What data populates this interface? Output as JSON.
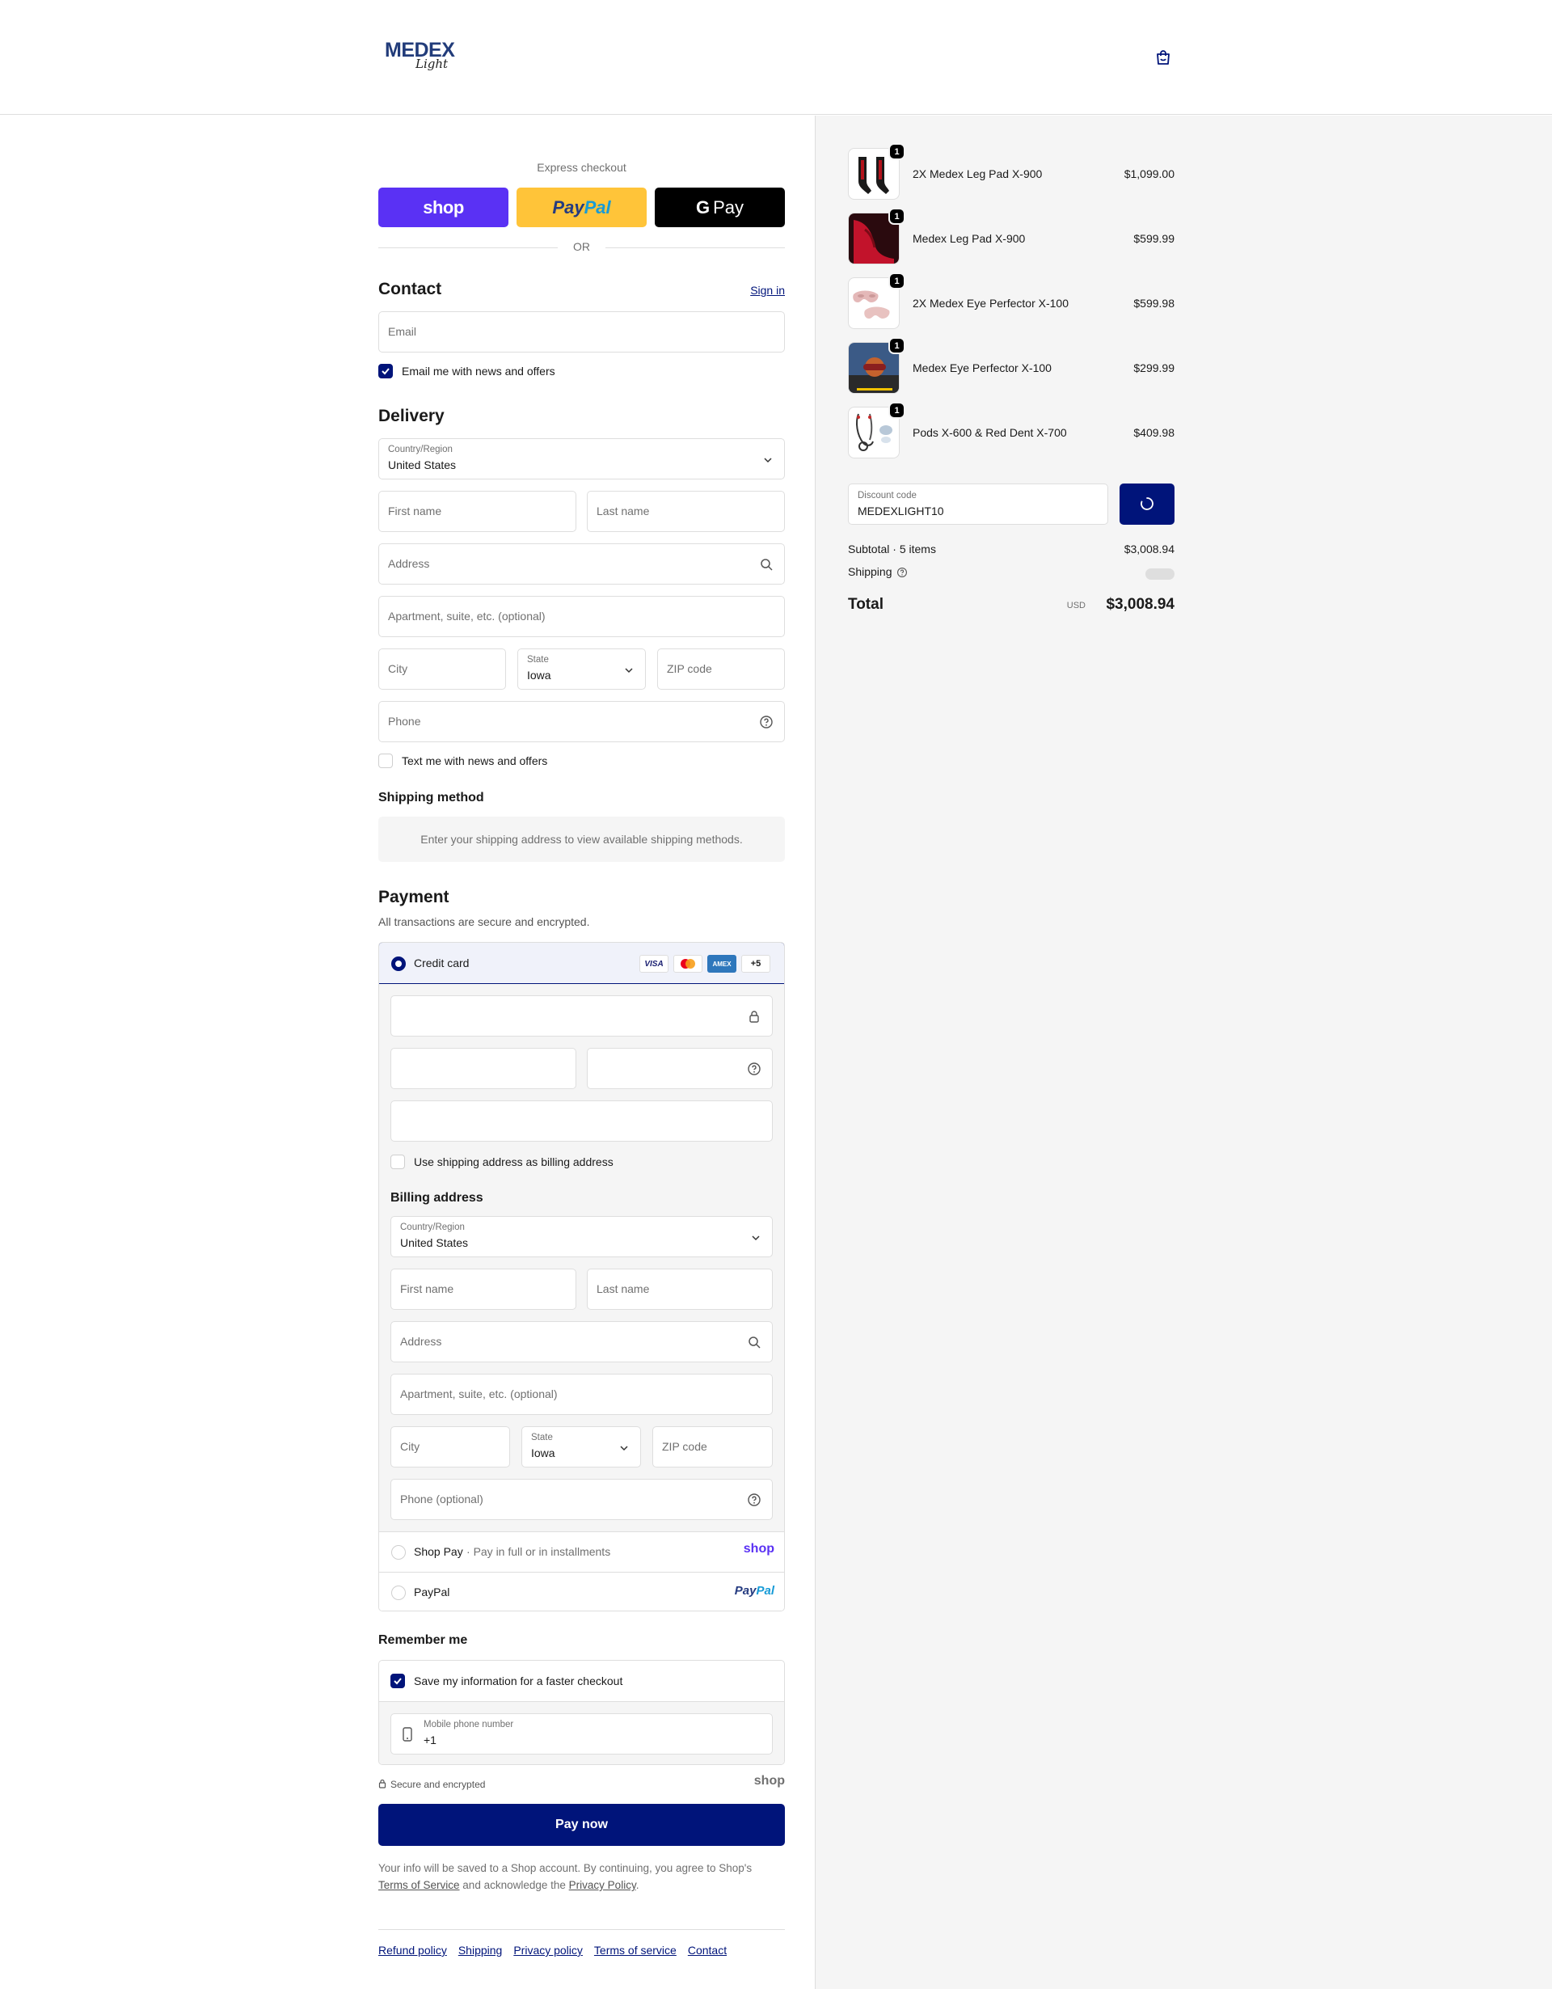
{
  "header": {
    "logo_word": "MEDEX",
    "logo_script": "Light"
  },
  "express": {
    "label": "Express checkout",
    "shop_label": "shop",
    "paypal_part1": "Pay",
    "paypal_part2": "Pal",
    "gpay_g": "G",
    "gpay_label": "Pay",
    "or_text": "OR"
  },
  "contact": {
    "title": "Contact",
    "sign_in": "Sign in",
    "email_placeholder": "Email",
    "news_label": "Email me with news and offers",
    "news_checked": true
  },
  "delivery": {
    "title": "Delivery",
    "country_label": "Country/Region",
    "country_value": "United States",
    "first_name": "First name",
    "last_name": "Last name",
    "address": "Address",
    "apartment": "Apartment, suite, etc. (optional)",
    "city": "City",
    "state_label": "State",
    "state_value": "Iowa",
    "zip": "ZIP code",
    "phone": "Phone",
    "text_label": "Text me with news and offers",
    "text_checked": false
  },
  "shipping_method": {
    "title": "Shipping method",
    "info": "Enter your shipping address to view available shipping methods."
  },
  "payment": {
    "title": "Payment",
    "subtitle": "All transactions are secure and encrypted.",
    "credit_card_label": "Credit card",
    "card_badges": [
      "VISA",
      "MC",
      "AMEX",
      "+5"
    ],
    "use_shipping_label": "Use shipping address as billing address",
    "billing_title": "Billing address",
    "billing": {
      "country_label": "Country/Region",
      "country_value": "United States",
      "first_name": "First name",
      "last_name": "Last name",
      "address": "Address",
      "apartment": "Apartment, suite, etc. (optional)",
      "city": "City",
      "state_label": "State",
      "state_value": "Iowa",
      "zip": "ZIP code",
      "phone": "Phone (optional)"
    },
    "shop_pay_label": "Shop Pay",
    "shop_pay_sub": "Pay in full or in installments",
    "shop_pay_logo": "shop",
    "paypal_label": "PayPal",
    "paypal_logo_1": "Pay",
    "paypal_logo_2": "Pal"
  },
  "remember": {
    "title": "Remember me",
    "save_label": "Save my information for a faster checkout",
    "mobile_label": "Mobile phone number",
    "mobile_value": "+1",
    "secure_text": "Secure and encrypted",
    "shop_logo": "shop"
  },
  "pay_now": "Pay now",
  "legal": {
    "line1": "Your info will be saved to a Shop account. By continuing, you agree to Shop's",
    "tos": "Terms of Service",
    "and_ack": "and acknowledge the",
    "privacy": "Privacy Policy",
    "end": "."
  },
  "footer_links": [
    "Refund policy",
    "Shipping",
    "Privacy policy",
    "Terms of service",
    "Contact"
  ],
  "order": {
    "items": [
      {
        "name": "2X Medex Leg Pad X-900",
        "price": "$1,099.00",
        "qty": "1"
      },
      {
        "name": "Medex Leg Pad X-900",
        "price": "$599.99",
        "qty": "1"
      },
      {
        "name": "2X Medex Eye Perfector X-100",
        "price": "$599.98",
        "qty": "1"
      },
      {
        "name": "Medex Eye Perfector X-100",
        "price": "$299.99",
        "qty": "1"
      },
      {
        "name": "Pods X-600 & Red Dent X-700",
        "price": "$409.98",
        "qty": "1"
      }
    ],
    "discount_label": "Discount code",
    "discount_value": "MEDEXLIGHT10",
    "subtotal_label": "Subtotal · 5 items",
    "subtotal_value": "$3,008.94",
    "shipping_label": "Shipping",
    "total_label": "Total",
    "currency": "USD",
    "total_value": "$3,008.94"
  },
  "colors": {
    "accent": "#00147a",
    "shop_purple": "#5a31f4",
    "paypal_yellow": "#ffc439"
  }
}
